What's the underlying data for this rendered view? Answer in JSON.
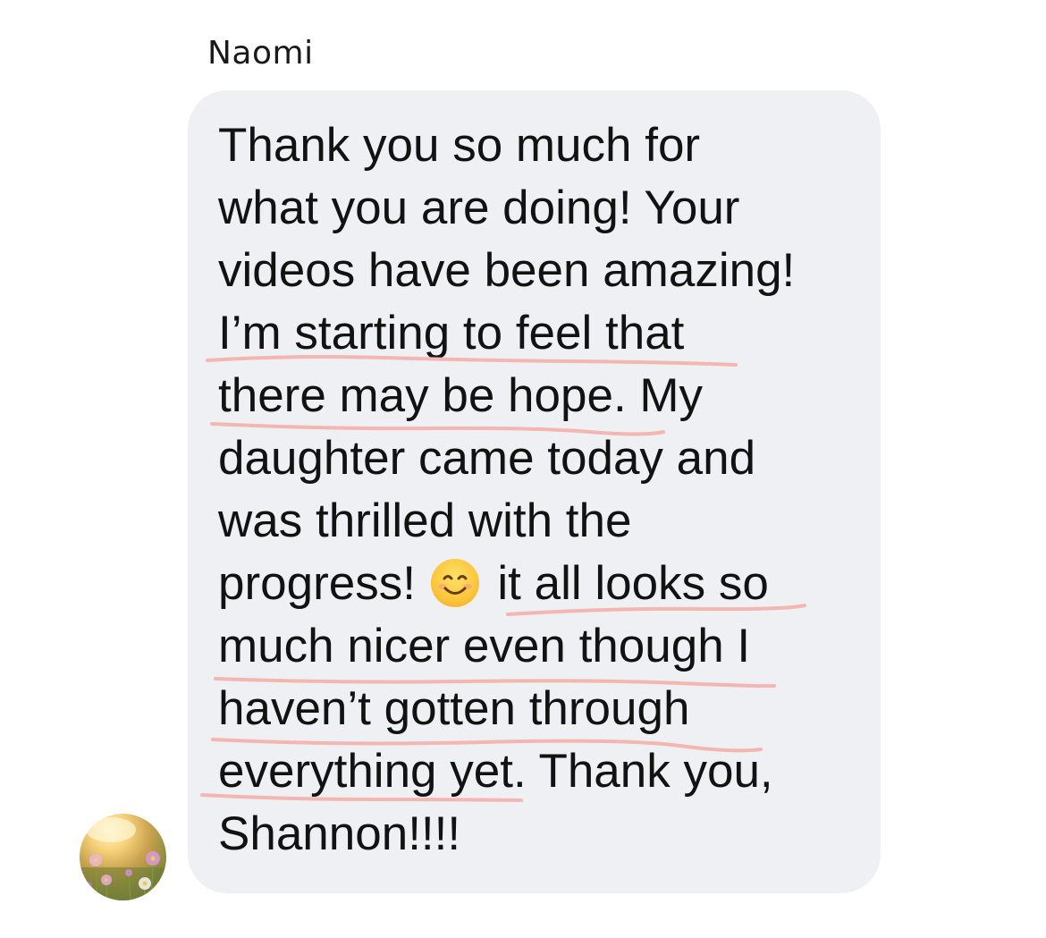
{
  "message": {
    "sender_name": "Naomi",
    "lines": [
      "Thank you so much for",
      "what you are doing! Your",
      "videos have been amazing!",
      "I’m starting to feel that",
      "there may be hope. My",
      "daughter came today and",
      "was thrilled with the",
      "progress!",
      "it all looks so",
      "much nicer even though I",
      "haven’t gotten through",
      "everything yet. Thank you,",
      "Shannon!!!!"
    ],
    "emoji": "smiling-face-icon",
    "highlight_color": "#f4b6b1",
    "bubble_color": "#eef0f3"
  },
  "avatar": {
    "icon": "flower-field-photo-avatar"
  }
}
